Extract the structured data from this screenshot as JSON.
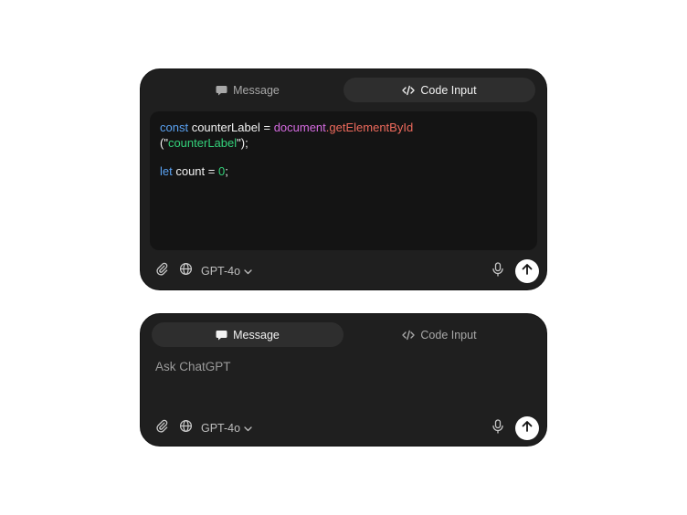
{
  "top_card": {
    "tabs": [
      {
        "label": "Message",
        "icon": "chat-bubble-icon",
        "active": false
      },
      {
        "label": "Code Input",
        "icon": "code-icon",
        "active": true
      }
    ],
    "code": {
      "line1": [
        {
          "text": "const",
          "color": "#5aa2f2"
        },
        {
          "text": " counterLabel = ",
          "color": "#f2f2f2"
        },
        {
          "text": "document",
          "color": "#d56be0"
        },
        {
          "text": ".getElementById",
          "color": "#ee6a5c"
        }
      ],
      "line2": [
        {
          "text": "(\"",
          "color": "#f2f2f2"
        },
        {
          "text": "counterLabel",
          "color": "#33d17a"
        },
        {
          "text": "\");",
          "color": "#f2f2f2"
        }
      ],
      "line3": [
        {
          "text": "let",
          "color": "#5aa2f2"
        },
        {
          "text": " count = ",
          "color": "#f2f2f2"
        },
        {
          "text": "0",
          "color": "#33d17a"
        },
        {
          "text": ";",
          "color": "#f2f2f2"
        }
      ]
    },
    "toolbar": {
      "model": "GPT-4o",
      "icons": [
        "paperclip-icon",
        "globe-icon",
        "chevron-down-icon",
        "microphone-icon",
        "arrow-up-icon"
      ]
    }
  },
  "bottom_card": {
    "tabs": [
      {
        "label": "Message",
        "icon": "chat-bubble-icon",
        "active": true
      },
      {
        "label": "Code Input",
        "icon": "code-icon",
        "active": false
      }
    ],
    "input": {
      "placeholder": "Ask ChatGPT",
      "value": ""
    },
    "toolbar": {
      "model": "GPT-4o",
      "icons": [
        "paperclip-icon",
        "globe-icon",
        "chevron-down-icon",
        "microphone-icon",
        "arrow-up-icon"
      ]
    }
  },
  "colors": {
    "card_bg": "#1f1f1f",
    "code_bg": "#141414",
    "active_tab_bg": "#2e2e2e",
    "send_button_bg": "#ffffff",
    "page_bg": "#ffffff"
  }
}
